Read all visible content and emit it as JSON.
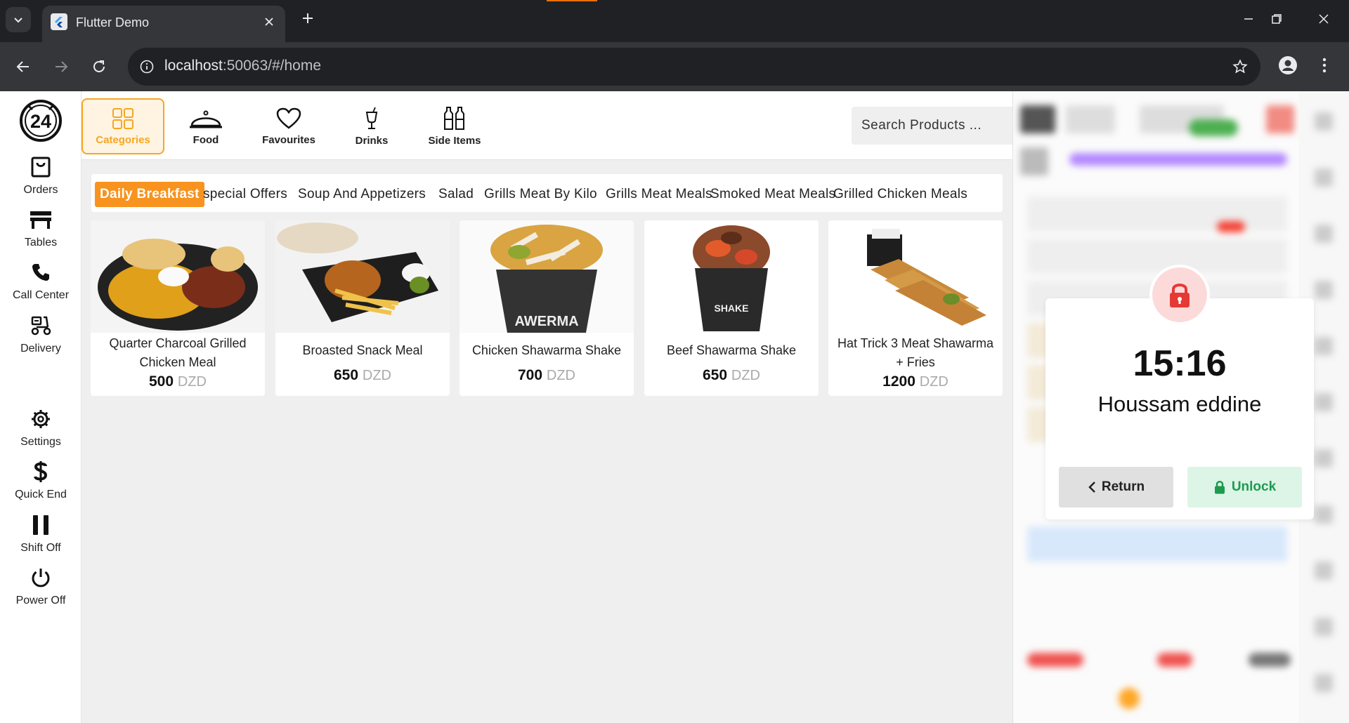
{
  "browser": {
    "tab_title": "Flutter Demo",
    "url_host": "localhost",
    "url_path": ":50063/#/home"
  },
  "nav": {
    "logo_text": "24",
    "items": [
      {
        "label": "Orders",
        "icon": "shopping-bag-icon"
      },
      {
        "label": "Tables",
        "icon": "table-icon"
      },
      {
        "label": "Call Center",
        "icon": "phone-icon"
      },
      {
        "label": "Delivery",
        "icon": "scooter-icon"
      },
      {
        "label": "Settings",
        "icon": "gear-icon"
      },
      {
        "label": "Quick End",
        "icon": "dollar-icon"
      },
      {
        "label": "Shift Off",
        "icon": "pause-icon"
      },
      {
        "label": "Power Off",
        "icon": "power-icon"
      }
    ]
  },
  "top_categories": [
    {
      "label": "Categories",
      "icon": "grid-icon",
      "active": true
    },
    {
      "label": "Food",
      "icon": "cloche-icon",
      "active": false
    },
    {
      "label": "Favourites",
      "icon": "heart-icon",
      "active": false
    },
    {
      "label": "Drinks",
      "icon": "drink-icon",
      "active": false
    },
    {
      "label": "Side Items",
      "icon": "bottles-icon",
      "active": false
    }
  ],
  "search": {
    "placeholder": "Search Products ..."
  },
  "subcategories": [
    {
      "label": "Daily Breakfast",
      "active": true
    },
    {
      "label": "special Offers"
    },
    {
      "label": "Soup And Appetizers"
    },
    {
      "label": "Salad"
    },
    {
      "label": "Grills Meat By Kilo"
    },
    {
      "label": "Grills Meat Meals"
    },
    {
      "label": "Smoked Meat Meals"
    },
    {
      "label": "Grilled Chicken Meals"
    }
  ],
  "products": [
    {
      "name": "Quarter Charcoal Grilled Chicken Meal",
      "price": "500",
      "currency": "DZD"
    },
    {
      "name": "Broasted Snack Meal",
      "price": "650",
      "currency": "DZD"
    },
    {
      "name": "Chicken Shawarma Shake",
      "price": "700",
      "currency": "DZD"
    },
    {
      "name": "Beef Shawarma Shake",
      "price": "650",
      "currency": "DZD"
    },
    {
      "name": "Hat Trick 3 Meat Shawarma + Fries",
      "price": "1200",
      "currency": "DZD"
    }
  ],
  "lock": {
    "time": "15:16",
    "user": "Houssam eddine",
    "return_label": "Return",
    "unlock_label": "Unlock"
  },
  "colors": {
    "accent": "#f7931e",
    "lock_red": "#e53935",
    "unlock_green": "#1e9a4f"
  }
}
